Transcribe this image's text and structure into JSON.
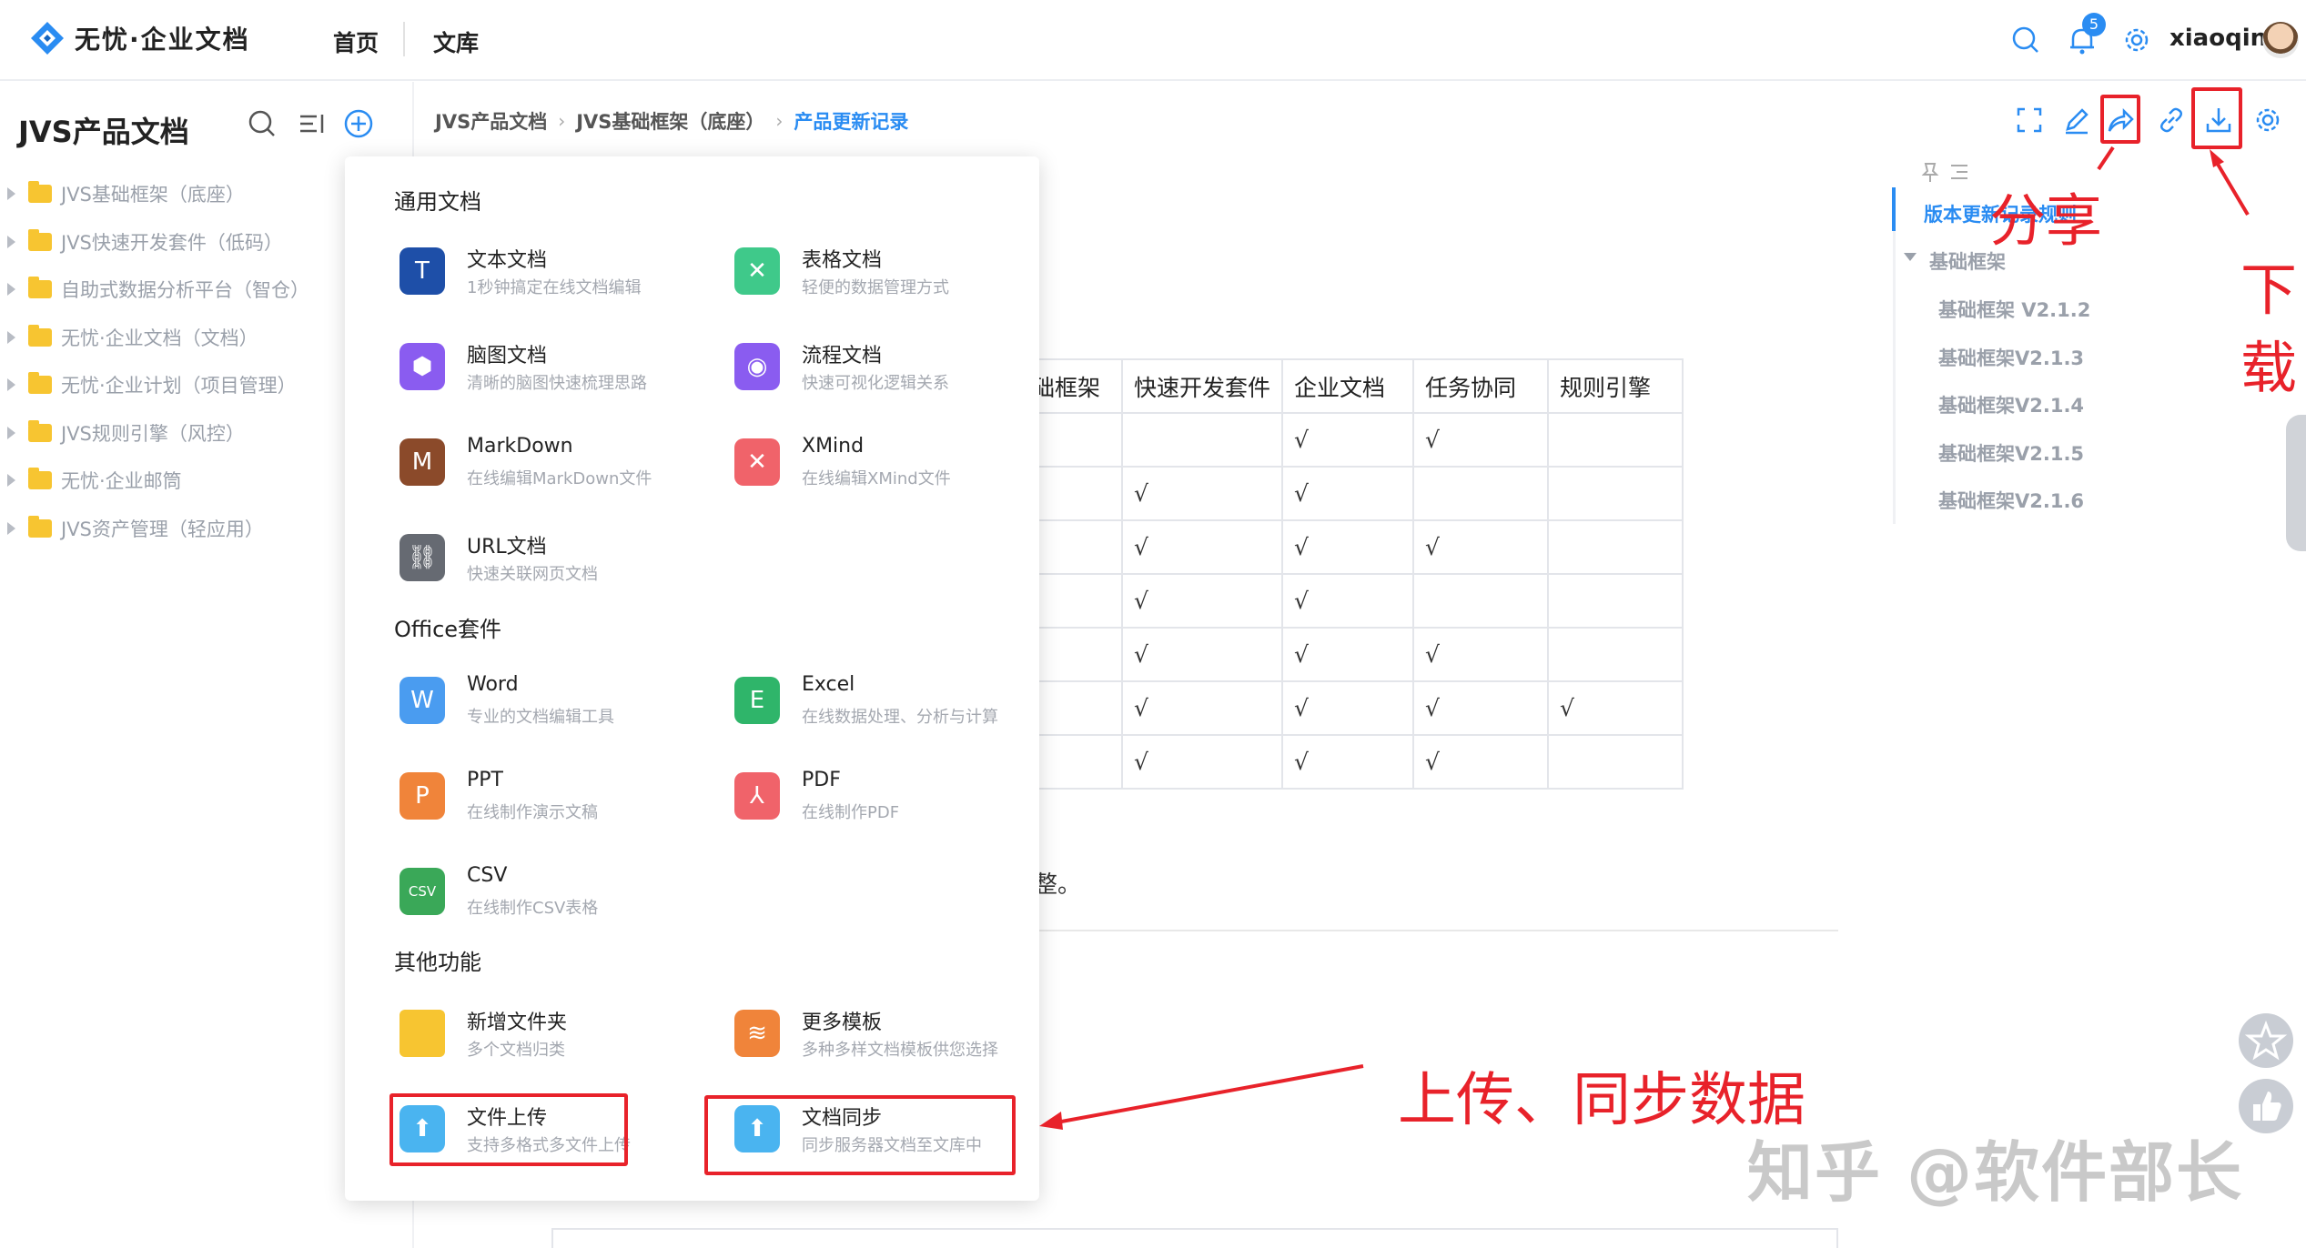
{
  "app": {
    "logo_text": "无忧·企业文档",
    "nav": [
      "首页",
      "文库"
    ],
    "notification_count": "5",
    "username": "xiaoqin"
  },
  "sidebar": {
    "title": "JVS产品文档",
    "items": [
      "JVS基础框架（底座）",
      "JVS快速开发套件（低码）",
      "自助式数据分析平台（智仓）",
      "无忧·企业文档（文档）",
      "无忧·企业计划（项目管理）",
      "JVS规则引擎（风控）",
      "无忧·企业邮筒",
      "JVS资产管理（轻应用）"
    ]
  },
  "breadcrumb": [
    "JVS产品文档",
    "JVS基础框架（底座）",
    "产品更新记录"
  ],
  "doc": {
    "table_headers": [
      "础框架",
      "快速开发套件",
      "企业文档",
      "任务协同",
      "规则引擎"
    ],
    "table_rows": [
      [
        "",
        "",
        "√",
        "√",
        ""
      ],
      [
        "",
        "√",
        "√",
        "",
        ""
      ],
      [
        "",
        "√",
        "√",
        "√",
        ""
      ],
      [
        "",
        "√",
        "√",
        "",
        ""
      ],
      [
        "",
        "√",
        "√",
        "√",
        ""
      ],
      [
        "",
        "√",
        "√",
        "√",
        "√"
      ],
      [
        "",
        "√",
        "√",
        "√",
        ""
      ]
    ],
    "trailing_text": "整。"
  },
  "outline": {
    "items": [
      "版本更新记录规则",
      "基础框架",
      "基础框架 V2.1.2",
      "基础框架V2.1.3",
      "基础框架V2.1.4",
      "基础框架V2.1.5",
      "基础框架V2.1.6"
    ]
  },
  "menu": {
    "section_general": "通用文档",
    "section_office": "Office套件",
    "section_other": "其他功能",
    "general": [
      {
        "title": "文本文档",
        "desc": "1秒钟搞定在线文档编辑",
        "icon": "text-doc-icon",
        "glyph": "T",
        "color": "#1e4fa8"
      },
      {
        "title": "表格文档",
        "desc": "轻便的数据管理方式",
        "icon": "sheet-doc-icon",
        "glyph": "✕",
        "color": "#3fc98a"
      },
      {
        "title": "脑图文档",
        "desc": "清晰的脑图快速梳理思路",
        "icon": "mindmap-doc-icon",
        "glyph": "⬢",
        "color": "#8a5cf0"
      },
      {
        "title": "流程文档",
        "desc": "快速可视化逻辑关系",
        "icon": "flow-doc-icon",
        "glyph": "◉",
        "color": "#8a5cf0"
      },
      {
        "title": "MarkDown",
        "desc": "在线编辑MarkDown文件",
        "icon": "markdown-doc-icon",
        "glyph": "M",
        "color": "#8b4a2a"
      },
      {
        "title": "XMind",
        "desc": "在线编辑XMind文件",
        "icon": "xmind-doc-icon",
        "glyph": "✕",
        "color": "#f0636a"
      },
      {
        "title": "URL文档",
        "desc": "快速关联网页文档",
        "icon": "url-doc-icon",
        "glyph": "⛓",
        "color": "#666a72"
      }
    ],
    "office": [
      {
        "title": "Word",
        "desc": "专业的文档编辑工具",
        "icon": "word-icon",
        "glyph": "W",
        "color": "#4a9cf0"
      },
      {
        "title": "Excel",
        "desc": "在线数据处理、分析与计算",
        "icon": "excel-icon",
        "glyph": "E",
        "color": "#2fb56a"
      },
      {
        "title": "PPT",
        "desc": "在线制作演示文稿",
        "icon": "ppt-icon",
        "glyph": "P",
        "color": "#f0843a"
      },
      {
        "title": "PDF",
        "desc": "在线制作PDF",
        "icon": "pdf-icon",
        "glyph": "⅄",
        "color": "#f0636a"
      },
      {
        "title": "CSV",
        "desc": "在线制作CSV表格",
        "icon": "csv-icon",
        "glyph": "CSV",
        "color": "#3aa858"
      }
    ],
    "other": [
      {
        "title": "新增文件夹",
        "desc": "多个文档归类",
        "icon": "folder-icon",
        "glyph": "",
        "color": "#f7c531"
      },
      {
        "title": "更多模板",
        "desc": "多种多样文档模板供您选择",
        "icon": "template-icon",
        "glyph": "≋",
        "color": "#f0843a"
      },
      {
        "title": "文件上传",
        "desc": "支持多格式多文件上传",
        "icon": "upload-icon",
        "glyph": "⬆",
        "color": "#4ab4f0"
      },
      {
        "title": "文档同步",
        "desc": "同步服务器文档至文库中",
        "icon": "sync-icon",
        "glyph": "⬆",
        "color": "#4ab4f0"
      }
    ]
  },
  "annotations": {
    "share": "分享",
    "download_1": "下",
    "download_2": "载",
    "upload_sync": "上传、同步数据",
    "watermark": "知乎 @软件部长",
    "accent": "#e8222a"
  }
}
